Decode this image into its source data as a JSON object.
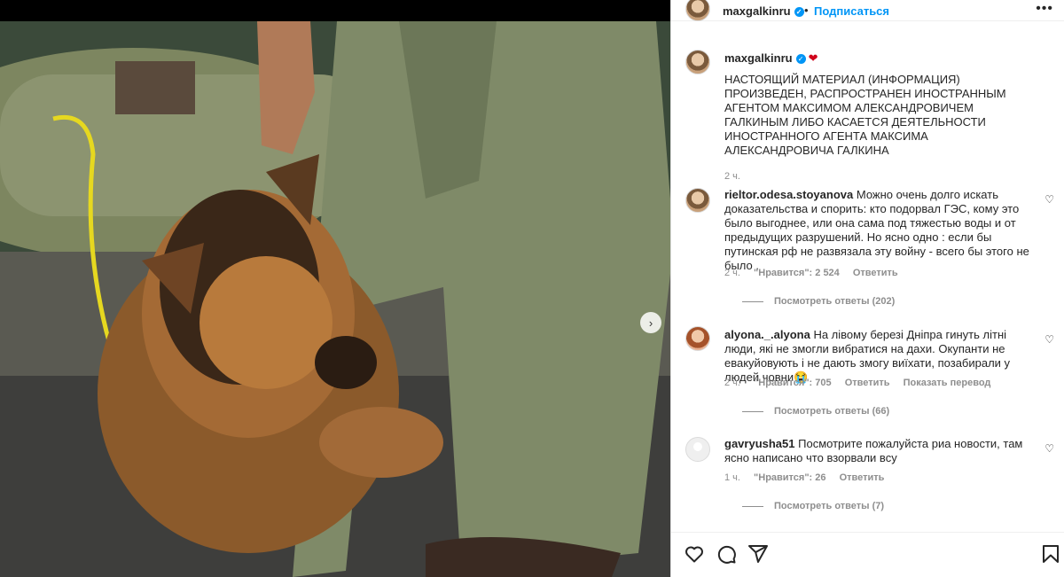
{
  "header": {
    "username": "maxgalkinru",
    "separator": "•",
    "follow": "Подписаться",
    "more": "•••"
  },
  "caption": {
    "username": "maxgalkinru",
    "text": "НАСТОЯЩИЙ МАТЕРИАЛ (ИНФОРМАЦИЯ) ПРОИЗВЕДЕН, РАСПРОСТРАНЕН ИНОСТРАННЫМ АГЕНТОМ МАКСИМОМ АЛЕКСАНДРОВИЧЕМ ГАЛКИНЫМ ЛИБО КАСАЕТСЯ ДЕЯТЕЛЬНОСТИ ИНОСТРАННОГО АГЕНТА МАКСИМА АЛЕКСАНДРОВИЧА ГАЛКИНА",
    "time": "2 ч."
  },
  "comments": [
    {
      "username": "rieltor.odesa.stoyanova",
      "text": "Можно очень долго искать доказательства и спорить: кто подорвал ГЭС, кому это было выгоднее, или она сама под тяжестью воды и от предыдущих разрушений. Но ясно одно : если бы путинская рф не развязала эту войну - всего бы этого не было .",
      "time": "2 ч.",
      "likes": "\"Нравится\": 2 524",
      "reply": "Ответить",
      "view_replies": "Посмотреть ответы (202)"
    },
    {
      "username": "alyona._.alyona",
      "text": "На лівому березі Дніпра гинуть літні люди, які не змогли вибратися на дахи. Окупанти не евакуйовують і не дають змогу виїхати, позабирали у людей човни😭",
      "time": "2 ч.",
      "likes": "\"Нравится\": 705",
      "reply": "Ответить",
      "translate": "Показать перевод",
      "view_replies": "Посмотреть ответы (66)"
    },
    {
      "username": "gavryusha51",
      "text": "Посмотрите пожалуйста риа новости, там ясно написано что взорвали всу",
      "time": "1 ч.",
      "likes": "\"Нравится\": 26",
      "reply": "Ответить",
      "view_replies": "Посмотреть ответы (7)"
    }
  ],
  "icons": {
    "next": "›",
    "heart": "♡",
    "heart_red": "❤"
  },
  "colors": {
    "accent": "#0095f6",
    "muted": "#8e8e8e",
    "text": "#262626"
  }
}
